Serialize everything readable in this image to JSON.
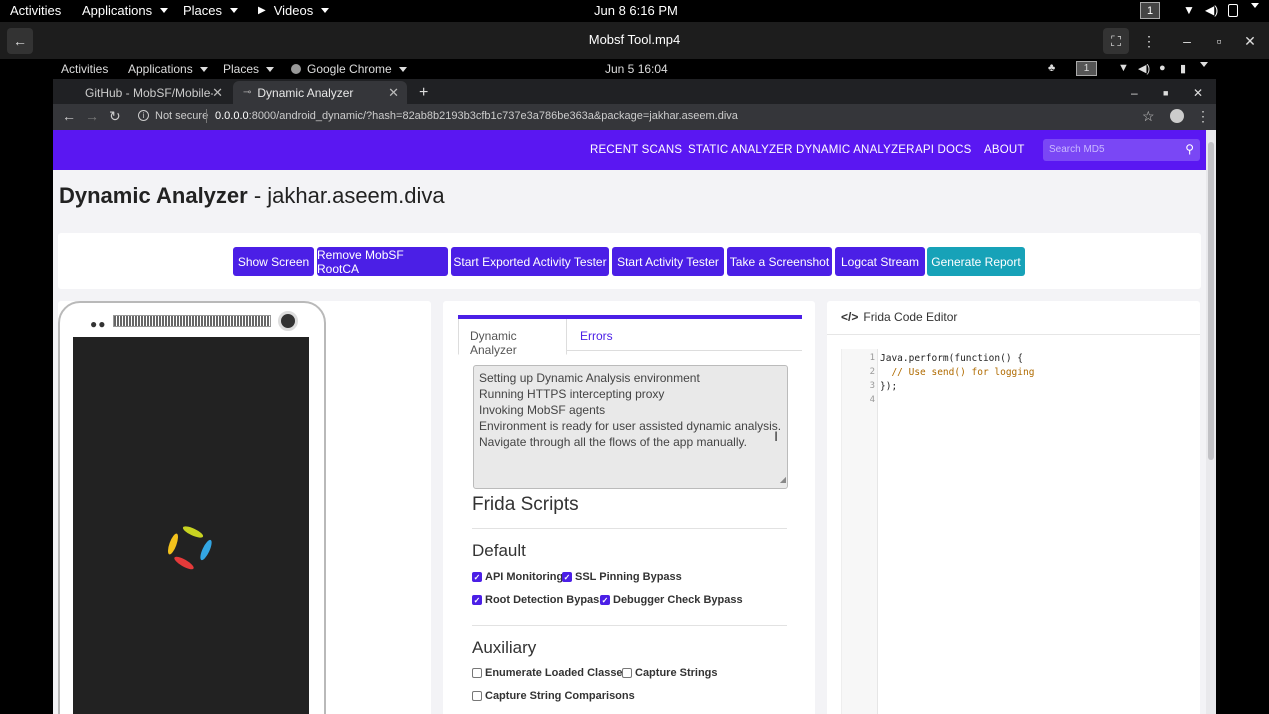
{
  "outer_bar": {
    "activities": "Activities",
    "applications": "Applications",
    "places": "Places",
    "videos": "Videos",
    "clock": "Jun 8  6:16 PM",
    "workspace": "1"
  },
  "player": {
    "title": "Mobsf Tool.mp4"
  },
  "inner_bar": {
    "activities": "Activities",
    "applications": "Applications",
    "places": "Places",
    "app": "Google Chrome",
    "clock": "Jun 5  16:04",
    "workspace": "1"
  },
  "tabs": [
    {
      "label": "GitHub - MobSF/Mobile-S"
    },
    {
      "label": "Dynamic Analyzer"
    }
  ],
  "address": {
    "security": "Not secure",
    "url_host": "0.0.0.0",
    "url_rest": ":8000/android_dynamic/?hash=82ab8b2193b3cfb1c737e3a786be363a&package=jakhar.aseem.diva"
  },
  "nav": {
    "items": [
      "RECENT SCANS",
      "STATIC ANALYZER",
      "DYNAMIC ANALYZER",
      "API DOCS",
      "ABOUT"
    ],
    "search_placeholder": "Search MD5"
  },
  "page": {
    "title_bold": "Dynamic Analyzer",
    "title_rest": " - jakhar.aseem.diva"
  },
  "actions": [
    "Show Screen",
    "Remove MobSF RootCA",
    "Start Exported Activity Tester",
    "Start Activity Tester",
    "Take a Screenshot",
    "Logcat Stream",
    "Generate Report"
  ],
  "analyzer": {
    "tab_active": "Dynamic Analyzer",
    "tab_errors": "Errors",
    "log": [
      "Setting up Dynamic Analysis environment",
      "Running HTTPS intercepting proxy",
      "Invoking MobSF agents",
      "Environment is ready for user assisted dynamic analysis.",
      "Navigate through all the flows of the app manually."
    ],
    "frida_title": "Frida Scripts",
    "default_title": "Default",
    "default_scripts": [
      {
        "label": "API Monitoring",
        "checked": true
      },
      {
        "label": "SSL Pinning Bypass",
        "checked": true
      },
      {
        "label": "Root Detection Bypass",
        "checked": true
      },
      {
        "label": "Debugger Check Bypass",
        "checked": true
      }
    ],
    "aux_title": "Auxiliary",
    "aux_scripts": [
      {
        "label": "Enumerate Loaded Classes",
        "checked": false
      },
      {
        "label": "Capture Strings",
        "checked": false
      },
      {
        "label": "Capture String Comparisons",
        "checked": false
      }
    ]
  },
  "editor": {
    "title": "Frida Code Editor",
    "line_numbers": [
      "1",
      "2",
      "3",
      "4"
    ],
    "code": [
      "Java.perform(function() {",
      "  // Use send() for logging",
      "});",
      ""
    ]
  },
  "colors": {
    "accent": "#5a17f2",
    "button": "#4b1fe6",
    "teal": "#17a2b8"
  }
}
